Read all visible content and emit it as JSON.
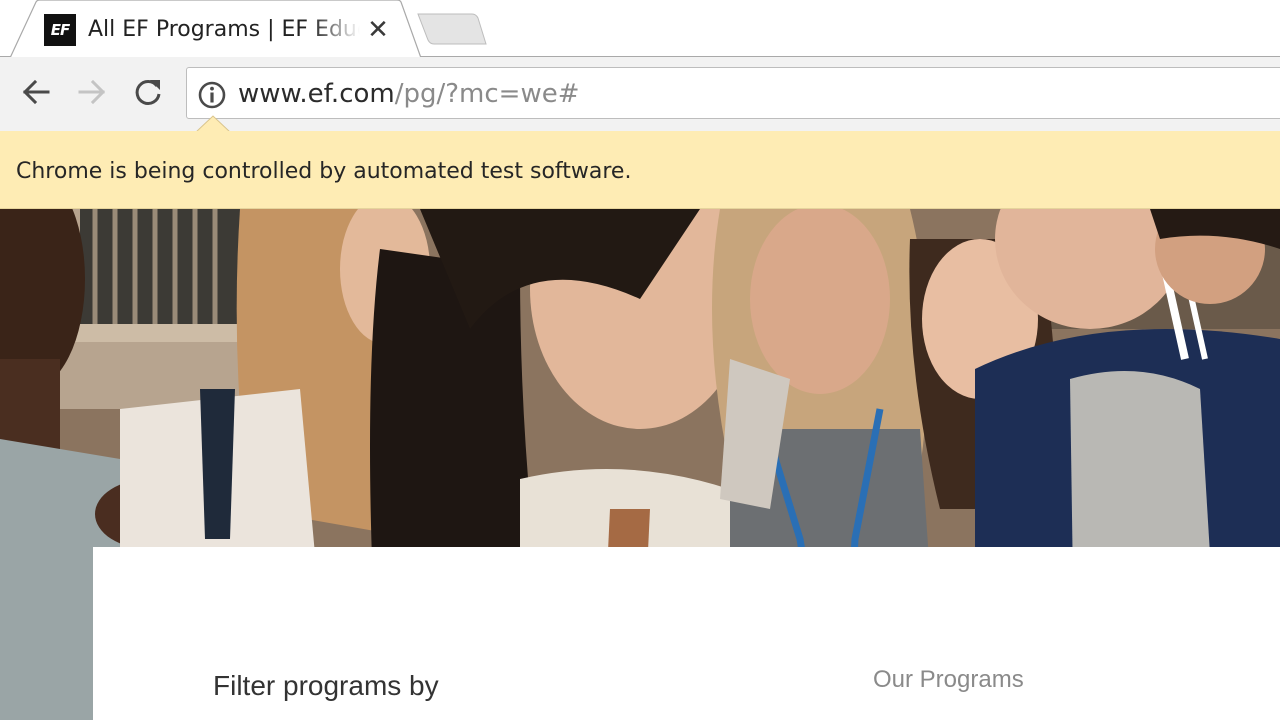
{
  "browser": {
    "tab": {
      "favicon_text": "EF",
      "title": "All EF Programs | EF Education First",
      "close_glyph": "✕"
    },
    "address_bar": {
      "url_host": "www.ef.com",
      "url_path": "/pg/?mc=we#"
    },
    "infobar": {
      "message": "Chrome is being controlled by automated test software."
    }
  },
  "page": {
    "hero_image": "group-of-people-looking-up-photo",
    "filter_heading": "Filter programs by",
    "programs_heading": "Our Programs"
  },
  "colors": {
    "infobar_background": "#feecb4",
    "toolbar_background": "#f2f2f2",
    "url_path_color": "#8a8a8a"
  }
}
